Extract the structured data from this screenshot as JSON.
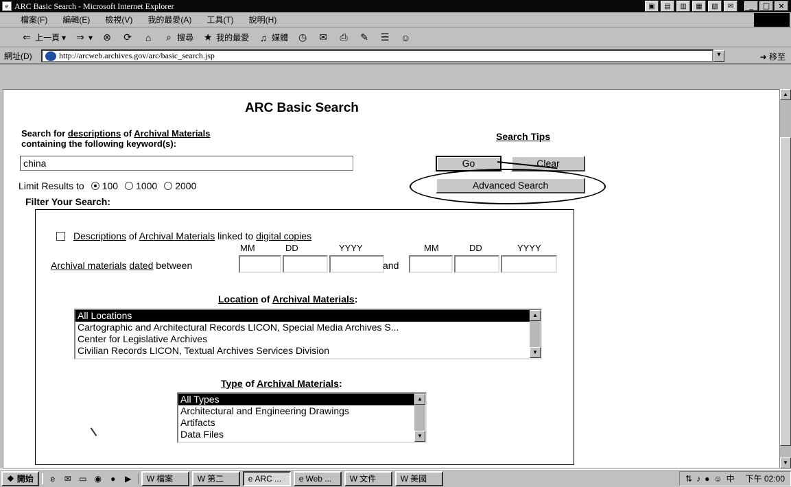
{
  "window": {
    "title": "ARC Basic Search - Microsoft Internet Explorer",
    "controls": [
      "_",
      "□",
      "×"
    ]
  },
  "menubar": {
    "items": [
      "檔案(F)",
      "編輯(E)",
      "檢視(V)",
      "我的最愛(A)",
      "工具(T)",
      "說明(H)"
    ]
  },
  "toolbar": {
    "back_label": "上一頁",
    "search_label": "搜尋",
    "favorites_label": "我的最愛",
    "media_label": "媒體"
  },
  "address": {
    "label": "網址(D)",
    "url": "http://arcweb.archives.gov/arc/basic_search.jsp",
    "go_label": "移至"
  },
  "page": {
    "title": "ARC Basic Search",
    "desc_prefix": "Search for ",
    "desc_link1": "descriptions",
    "desc_mid": " of ",
    "desc_link2": "Archival Materials",
    "desc_line2": "containing the following keyword(s):",
    "keyword_value": "china",
    "limit_label": "Limit Results to",
    "limit_options": [
      "100",
      "1000",
      "2000"
    ],
    "limit_selected": "100",
    "filter_label": "Filter Your Search:",
    "search_tips": "Search Tips",
    "go_button": "Go",
    "clear_button": "Clear",
    "advanced_button": "Advanced Search"
  },
  "filter": {
    "digital_link1": "Descriptions",
    "digital_mid1": " of ",
    "digital_link2": "Archival Materials",
    "digital_mid2": " linked to ",
    "digital_link3": "digital copies",
    "date_heads": [
      "MM",
      "DD",
      "YYYY",
      "MM",
      "DD",
      "YYYY"
    ],
    "date_link1": "Archival materials",
    "date_link2": "dated",
    "date_between": " between",
    "and_label": "and",
    "location_link1": "Location",
    "location_of": " of ",
    "location_link2": "Archival Materials",
    "location_colon": ":",
    "location_options": [
      "All Locations",
      "Cartographic and Architectural Records LICON, Special Media Archives S...",
      "Center for Legislative Archives",
      "Civilian Records LICON, Textual Archives Services Division"
    ],
    "type_link1": "Type",
    "type_of": " of ",
    "type_link2": "Archival Materials",
    "type_colon": ":",
    "type_options": [
      "All Types",
      "Architectural and Engineering Drawings",
      "Artifacts",
      "Data Files"
    ]
  },
  "taskbar": {
    "start_label": "開始",
    "tasks": [
      "檔案",
      "第二",
      "ARC ...",
      "Web ...",
      "文件",
      "美國"
    ],
    "active_task": "ARC ...",
    "clock": "下午 02:00"
  }
}
